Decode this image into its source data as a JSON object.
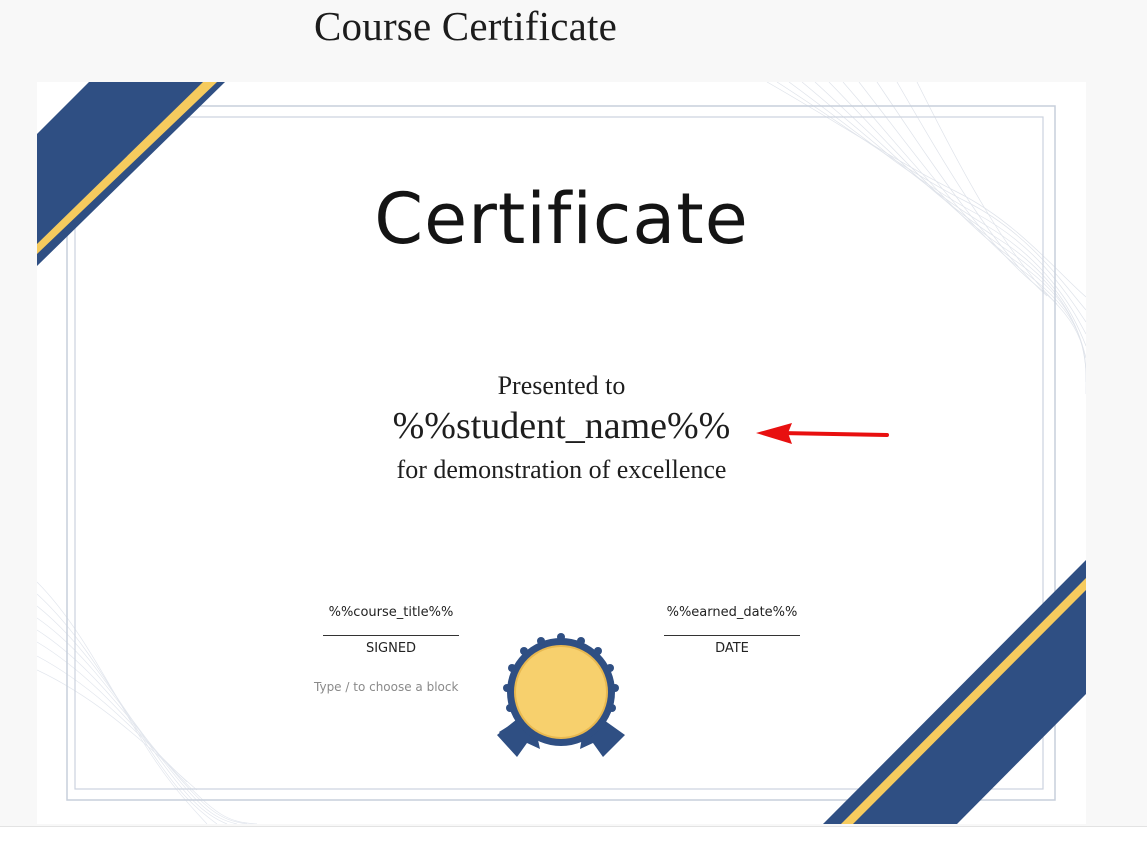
{
  "page": {
    "title": "Course Certificate"
  },
  "certificate": {
    "heading": "Certificate",
    "presented_to": "Presented to",
    "student_name": "%%student_name%%",
    "excellence_line": "for demonstration of excellence",
    "left_field": {
      "value": "%%course_title%%",
      "label": "SIGNED"
    },
    "right_field": {
      "value": "%%earned_date%%",
      "label": "DATE"
    },
    "block_hint": "Type / to choose a block"
  },
  "colors": {
    "ribbon_blue": "#2f4f83",
    "ribbon_gold": "#f6cb5e",
    "frame": "#c8d0dc",
    "seal_gold": "#f7d06d",
    "annotation_arrow": "#e81010"
  },
  "icons": {
    "seal": "award-badge-icon",
    "annotation": "red-arrow-icon"
  }
}
